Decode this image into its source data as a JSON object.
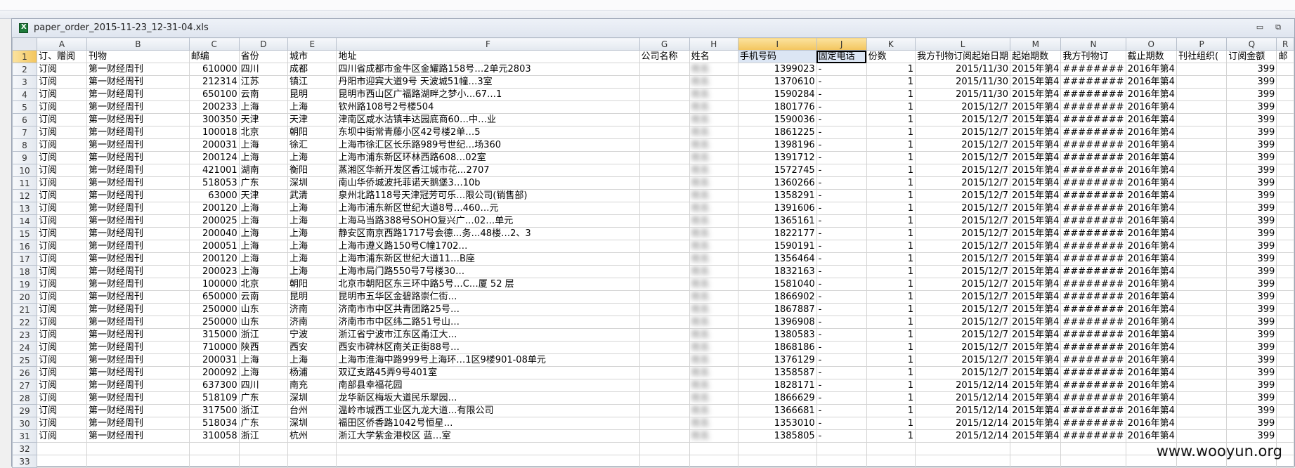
{
  "window": {
    "title": "paper_order_2015-11-23_12-31-04.xls",
    "minimize_glyph": "▭",
    "restore_glyph": "⧉"
  },
  "columns": [
    "A",
    "B",
    "C",
    "D",
    "E",
    "F",
    "G",
    "H",
    "I",
    "J",
    "K",
    "L",
    "M",
    "N",
    "O",
    "P",
    "Q",
    "R"
  ],
  "header": [
    "订、赠阅",
    "刊物",
    "邮编",
    "省份",
    "城市",
    "地址",
    "公司名称",
    "姓名",
    "手机号码",
    "固定电话",
    "份数",
    "我方刊物订阅起始日期",
    "起始期数",
    "我方刊物订",
    "截止期数",
    "刊社组织(",
    "订阅金额",
    "邮"
  ],
  "rows": [
    {
      "n": "2",
      "zip": "610000",
      "prov": "四川",
      "city": "成都",
      "addr": "四川省成都市金牛区金耀路158号…2单元2803",
      "phone": "1399023",
      "start": "2015/11/30"
    },
    {
      "n": "3",
      "zip": "212314",
      "prov": "江苏",
      "city": "镇江",
      "addr": "丹阳市迎宾大道9号 天波城51幢…3室",
      "phone": "1370610",
      "start": "2015/11/30"
    },
    {
      "n": "4",
      "zip": "650100",
      "prov": "云南",
      "city": "昆明",
      "addr": "昆明市西山区广福路湖畔之梦小…67…1",
      "phone": "1590284",
      "start": "2015/11/30"
    },
    {
      "n": "5",
      "zip": "200233",
      "prov": "上海",
      "city": "上海",
      "addr": "钦州路108号2号楼504",
      "phone": "1801776",
      "start": "2015/12/7"
    },
    {
      "n": "6",
      "zip": "300350",
      "prov": "天津",
      "city": "天津",
      "addr": "津南区咸水沽镇丰达园底商60…中…业",
      "phone": "1590036",
      "start": "2015/12/7"
    },
    {
      "n": "7",
      "zip": "100018",
      "prov": "北京",
      "city": "朝阳",
      "addr": "东坝中街常青藤小区42号楼2单…5",
      "phone": "1861225",
      "start": "2015/12/7"
    },
    {
      "n": "8",
      "zip": "200031",
      "prov": "上海",
      "city": "徐汇",
      "addr": "上海市徐汇区长乐路989号世纪…场360",
      "phone": "1398196",
      "start": "2015/12/7"
    },
    {
      "n": "9",
      "zip": "200124",
      "prov": "上海",
      "city": "上海",
      "addr": "上海市浦东新区环林西路608…02室",
      "phone": "1391712",
      "start": "2015/12/7"
    },
    {
      "n": "10",
      "zip": "421001",
      "prov": "湖南",
      "city": "衡阳",
      "addr": "蒸湘区华新开发区香江城市花…2707",
      "phone": "1572745",
      "start": "2015/12/7"
    },
    {
      "n": "11",
      "zip": "518053",
      "prov": "广东",
      "city": "深圳",
      "addr": "南山华侨城波托菲诺天鹅堡3…10b",
      "phone": "1360266",
      "start": "2015/12/7"
    },
    {
      "n": "12",
      "zip": "63000",
      "prov": "天津",
      "city": "武清",
      "addr": "泉州北路118号天津冠芳可乐…限公司(销售部)",
      "phone": "1358291",
      "start": "2015/12/7"
    },
    {
      "n": "13",
      "zip": "200120",
      "prov": "上海",
      "city": "上海",
      "addr": "上海市浦东新区世纪大道8号…460…元",
      "phone": "1391606",
      "start": "2015/12/7"
    },
    {
      "n": "14",
      "zip": "200025",
      "prov": "上海",
      "city": "上海",
      "addr": "上海马当路388号SOHO复兴广…02…单元",
      "phone": "1365161",
      "start": "2015/12/7"
    },
    {
      "n": "15",
      "zip": "200040",
      "prov": "上海",
      "city": "上海",
      "addr": "静安区南京西路1717号会德…务…48楼…2、3",
      "phone": "1822177",
      "start": "2015/12/7"
    },
    {
      "n": "16",
      "zip": "200051",
      "prov": "上海",
      "city": "上海",
      "addr": "上海市遵义路150号C幢1702…",
      "phone": "1590191",
      "start": "2015/12/7"
    },
    {
      "n": "17",
      "zip": "200120",
      "prov": "上海",
      "city": "上海",
      "addr": "上海市浦东新区世纪大道11…B座",
      "phone": "1356464",
      "start": "2015/12/7"
    },
    {
      "n": "18",
      "zip": "200023",
      "prov": "上海",
      "city": "上海",
      "addr": "上海市局门路550号7号楼30…",
      "phone": "1832163",
      "start": "2015/12/7"
    },
    {
      "n": "19",
      "zip": "100000",
      "prov": "北京",
      "city": "朝阳",
      "addr": "北京市朝阳区东三环中路5号…C…厦 52 层",
      "phone": "1581040",
      "start": "2015/12/7"
    },
    {
      "n": "20",
      "zip": "650000",
      "prov": "云南",
      "city": "昆明",
      "addr": "昆明市五华区金碧路崇仁街…",
      "phone": "1866902",
      "start": "2015/12/7"
    },
    {
      "n": "21",
      "zip": "250000",
      "prov": "山东",
      "city": "济南",
      "addr": "济南市市中区共青团路25号…",
      "phone": "1867887",
      "start": "2015/12/7"
    },
    {
      "n": "22",
      "zip": "250000",
      "prov": "山东",
      "city": "济南",
      "addr": "济南市市中区纬二路51号山…",
      "phone": "1396908",
      "start": "2015/12/7"
    },
    {
      "n": "23",
      "zip": "315000",
      "prov": "浙江",
      "city": "宁波",
      "addr": "浙江省宁波市江东区甬江大…",
      "phone": "1380583",
      "start": "2015/12/7"
    },
    {
      "n": "24",
      "zip": "710000",
      "prov": "陕西",
      "city": "西安",
      "addr": "西安市碑林区南关正街88号…",
      "phone": "1868186",
      "start": "2015/12/7"
    },
    {
      "n": "25",
      "zip": "200031",
      "prov": "上海",
      "city": "上海",
      "addr": "上海市淮海中路999号上海环…1区9楼901-08单元",
      "phone": "1376129",
      "start": "2015/12/7"
    },
    {
      "n": "26",
      "zip": "200092",
      "prov": "上海",
      "city": "杨浦",
      "addr": "双辽支路45弄9号401室",
      "phone": "1358587",
      "start": "2015/12/7"
    },
    {
      "n": "27",
      "zip": "637300",
      "prov": "四川",
      "city": "南充",
      "addr": "南部县幸福花园",
      "phone": "1828171",
      "start": "2015/12/14"
    },
    {
      "n": "28",
      "zip": "518109",
      "prov": "广东",
      "city": "深圳",
      "addr": "龙华新区梅坂大道民乐翠园…",
      "phone": "1866629",
      "start": "2015/12/14"
    },
    {
      "n": "29",
      "zip": "317500",
      "prov": "浙江",
      "city": "台州",
      "addr": "温岭市城西工业区九龙大道…有限公司",
      "phone": "1366681",
      "start": "2015/12/14"
    },
    {
      "n": "30",
      "zip": "518034",
      "prov": "广东",
      "city": "深圳",
      "addr": "福田区侨香路1042号恒星…",
      "phone": "1353010",
      "start": "2015/12/14"
    },
    {
      "n": "31",
      "zip": "310058",
      "prov": "浙江",
      "city": "杭州",
      "addr": "浙江大学紫金港校区 蓝…室",
      "phone": "1385805",
      "start": "2015/12/14"
    }
  ],
  "row_defaults": {
    "type": "订阅",
    "pub": "第一财经周刊",
    "company": "",
    "name": "姓名",
    "landline": "-",
    "qty": "1",
    "start_issue": "2015年第4",
    "pub_date": "########",
    "end_issue": "2016年第4",
    "org": "",
    "amount": "399"
  },
  "empty_rows": [
    "32",
    "33"
  ],
  "watermark": "www.wooyun.org"
}
